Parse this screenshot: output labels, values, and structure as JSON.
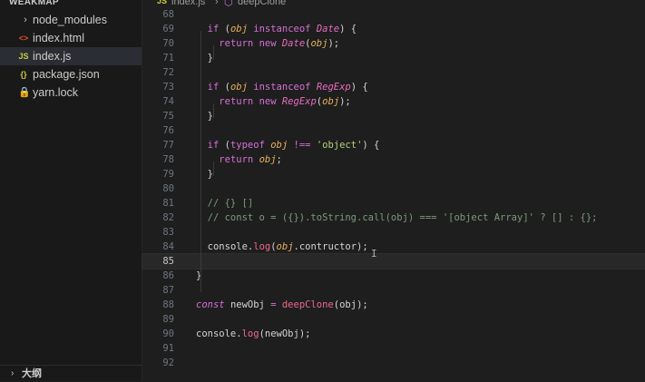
{
  "sidebar": {
    "title": "WEAKMAP",
    "items": [
      {
        "name": "node_modules",
        "icon": "chevron-right-icon",
        "glyph": "›",
        "icon_color": "#c5c5c5"
      },
      {
        "name": "index.html",
        "icon": "html-file-icon",
        "glyph": "<>",
        "icon_color": "#e44d26"
      },
      {
        "name": "index.js",
        "icon": "js-file-icon",
        "glyph": "JS",
        "icon_color": "#cbcb41",
        "selected": true
      },
      {
        "name": "package.json",
        "icon": "json-file-icon",
        "glyph": "{}",
        "icon_color": "#cbcb41"
      },
      {
        "name": "yarn.lock",
        "icon": "yarn-file-icon",
        "glyph": "🔒",
        "icon_color": "#2c8ebb"
      }
    ],
    "outline_label": "大纲"
  },
  "breadcrumb": {
    "file_icon": "JS",
    "file": "index.js",
    "separator": "›",
    "symbol_icon": "cube-icon",
    "symbol": "deepClone"
  },
  "editor": {
    "active_line": 85,
    "lines": [
      {
        "n": 68,
        "tokens": []
      },
      {
        "n": 69,
        "tokens": [
          [
            "  ",
            "p"
          ],
          [
            "if",
            "kw"
          ],
          [
            " (",
            "p"
          ],
          [
            "obj",
            "var"
          ],
          [
            " ",
            "p"
          ],
          [
            "instanceof",
            "kw"
          ],
          [
            " ",
            "p"
          ],
          [
            "Date",
            "cls"
          ],
          [
            ") {",
            "p"
          ]
        ]
      },
      {
        "n": 70,
        "tokens": [
          [
            "    ",
            "p"
          ],
          [
            "return",
            "kw"
          ],
          [
            " ",
            "p"
          ],
          [
            "new",
            "kw"
          ],
          [
            " ",
            "p"
          ],
          [
            "Date",
            "cls"
          ],
          [
            "(",
            "p"
          ],
          [
            "obj",
            "var"
          ],
          [
            ");",
            "p"
          ]
        ]
      },
      {
        "n": 71,
        "tokens": [
          [
            "  }",
            "p"
          ]
        ]
      },
      {
        "n": 72,
        "tokens": []
      },
      {
        "n": 73,
        "tokens": [
          [
            "  ",
            "p"
          ],
          [
            "if",
            "kw"
          ],
          [
            " (",
            "p"
          ],
          [
            "obj",
            "var"
          ],
          [
            " ",
            "p"
          ],
          [
            "instanceof",
            "kw"
          ],
          [
            " ",
            "p"
          ],
          [
            "RegExp",
            "cls"
          ],
          [
            ") {",
            "p"
          ]
        ]
      },
      {
        "n": 74,
        "tokens": [
          [
            "    ",
            "p"
          ],
          [
            "return",
            "kw"
          ],
          [
            " ",
            "p"
          ],
          [
            "new",
            "kw"
          ],
          [
            " ",
            "p"
          ],
          [
            "RegExp",
            "cls"
          ],
          [
            "(",
            "p"
          ],
          [
            "obj",
            "var"
          ],
          [
            ");",
            "p"
          ]
        ]
      },
      {
        "n": 75,
        "tokens": [
          [
            "  }",
            "p"
          ]
        ]
      },
      {
        "n": 76,
        "tokens": []
      },
      {
        "n": 77,
        "tokens": [
          [
            "  ",
            "p"
          ],
          [
            "if",
            "kw"
          ],
          [
            " (",
            "p"
          ],
          [
            "typeof",
            "kw"
          ],
          [
            " ",
            "p"
          ],
          [
            "obj",
            "var"
          ],
          [
            " ",
            "p"
          ],
          [
            "!==",
            "op"
          ],
          [
            " ",
            "p"
          ],
          [
            "'object'",
            "str"
          ],
          [
            ") {",
            "p"
          ]
        ]
      },
      {
        "n": 78,
        "tokens": [
          [
            "    ",
            "p"
          ],
          [
            "return",
            "kw"
          ],
          [
            " ",
            "p"
          ],
          [
            "obj",
            "var"
          ],
          [
            ";",
            "p"
          ]
        ]
      },
      {
        "n": 79,
        "tokens": [
          [
            "  }",
            "p"
          ]
        ]
      },
      {
        "n": 80,
        "tokens": []
      },
      {
        "n": 81,
        "tokens": [
          [
            "  // {} []",
            "cm"
          ]
        ]
      },
      {
        "n": 82,
        "tokens": [
          [
            "  // const o = ({}).toString.call(obj) === '[object Array]' ? [] : {};",
            "cm"
          ]
        ]
      },
      {
        "n": 83,
        "tokens": []
      },
      {
        "n": 84,
        "tokens": [
          [
            "  ",
            "p"
          ],
          [
            "console",
            "plain"
          ],
          [
            ".",
            "p"
          ],
          [
            "log",
            "fn"
          ],
          [
            "(",
            "p"
          ],
          [
            "obj",
            "var"
          ],
          [
            ".contructor);",
            "plain"
          ]
        ]
      },
      {
        "n": 85,
        "tokens": []
      },
      {
        "n": 86,
        "tokens": [
          [
            "}",
            "p"
          ]
        ]
      },
      {
        "n": 87,
        "tokens": []
      },
      {
        "n": 88,
        "tokens": [
          [
            "const",
            "kw"
          ],
          [
            " ",
            "p"
          ],
          [
            "newObj",
            "plain"
          ],
          [
            " ",
            "p"
          ],
          [
            "=",
            "op"
          ],
          [
            " ",
            "p"
          ],
          [
            "deepClone",
            "fn"
          ],
          [
            "(",
            "p"
          ],
          [
            "obj",
            "plain"
          ],
          [
            ");",
            "p"
          ]
        ]
      },
      {
        "n": 89,
        "tokens": []
      },
      {
        "n": 90,
        "tokens": [
          [
            "console",
            "plain"
          ],
          [
            ".",
            "p"
          ],
          [
            "log",
            "fn"
          ],
          [
            "(newObj);",
            "plain"
          ]
        ]
      },
      {
        "n": 91,
        "tokens": []
      },
      {
        "n": 92,
        "tokens": []
      }
    ],
    "cursor_glyph": "I"
  },
  "colors": {
    "kw": "#d670d6",
    "cls": "#e86bbf",
    "var": "#e8b35c",
    "str": "#b5d17a",
    "cm": "#7c9a7c",
    "fn": "#ec6a8f",
    "op": "#d670d6",
    "p": "#d4d4d4",
    "plain": "#d4d4d4"
  }
}
